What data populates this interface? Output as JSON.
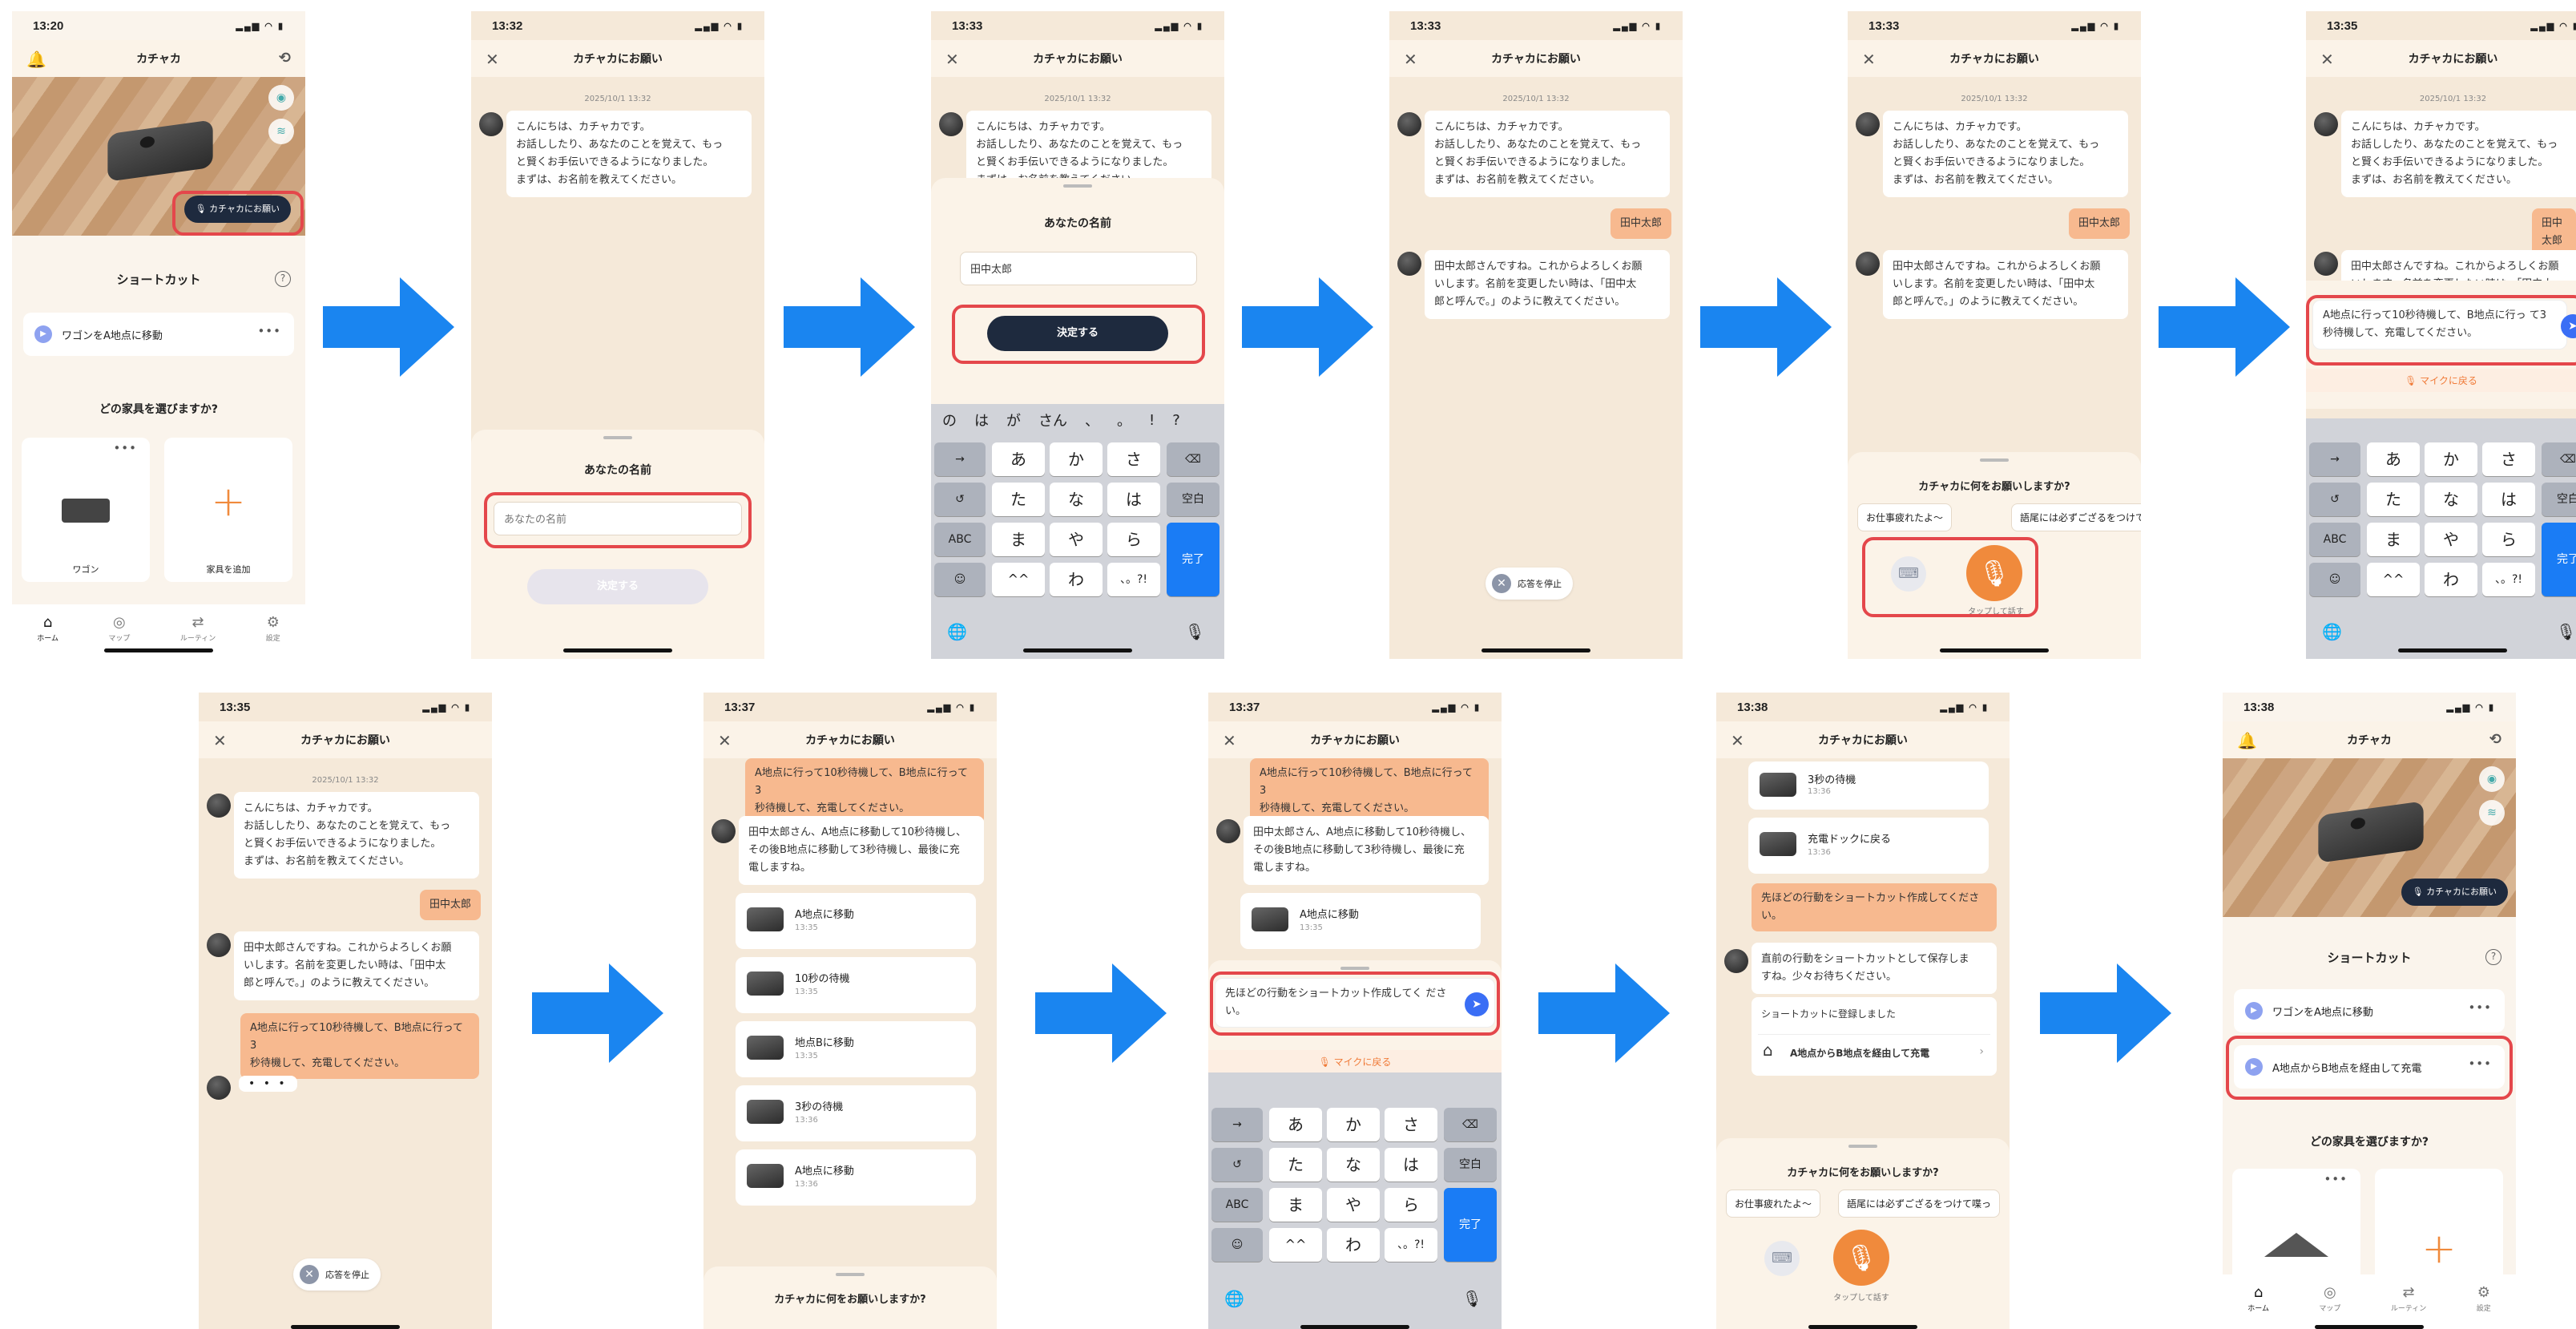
{
  "status": {
    "s1": "13:20",
    "s2": "13:32",
    "s3": "13:33",
    "s4": "13:33",
    "s5": "13:33",
    "s6": "13:35",
    "s7": "13:35",
    "s8": "13:37",
    "s9": "13:37",
    "s10": "13:38",
    "s11": "13:38",
    "icons": "▂▄▆ ◠ ▮"
  },
  "nav": {
    "home_title": "カチャカ",
    "chat_title": "カチャカにお願い",
    "close": "✕",
    "bell": "🔔",
    "history": "⟲"
  },
  "date": "2025/10/1 13:32",
  "chat": {
    "greeting": "こんにちは、カチャカです。\nお話ししたり、あなたのことを覚えて、もっ\nと賢くお手伝いできるようになりました。\nまずは、お名前を教えてください。",
    "user_name": "田中太郎",
    "reply_name": "田中太郎さんですね。これからよろしくお願\nいします。名前を変更したい時は、「田中太\n郎と呼んで。」のように教えてください。",
    "user_command": "A地点に行って10秒待機して、B地点に行って3\n秒待機して、充電してください。",
    "user_command_short": "A地点に行って10秒待機して、B地点に行って3\n秒待機して、充電してください。",
    "typing": "• • •",
    "plan": "田中太郎さん、A地点に移動して10秒待機し、\nその後B地点に移動して3秒待機し、最後に充\n電しますね。",
    "shortcut_request": "先ほどの行動をショートカット作成してくださ\nい。",
    "shortcut_reply": "直前の行動をショートカットとして保存しま\nすね。少々お待ちください。",
    "shortcut_done": "ショートカットに登録しました",
    "shortcut_name": "A地点からB地点を経由して充電"
  },
  "tasks": [
    {
      "title": "A地点に移動",
      "time": "13:35"
    },
    {
      "title": "10秒の待機",
      "time": "13:35"
    },
    {
      "title": "地点Bに移動",
      "time": "13:35"
    },
    {
      "title": "3秒の待機",
      "time": "13:36"
    },
    {
      "title": "A地点に移動",
      "time": "13:36"
    }
  ],
  "tasks_s10": [
    {
      "title": "3秒の待機",
      "time": "13:36"
    },
    {
      "title": "充電ドックに戻る",
      "time": "13:36"
    }
  ],
  "name_sheet": {
    "title": "あなたの名前",
    "placeholder": "あなたの名前",
    "value": "田中太郎",
    "decide": "決定する"
  },
  "compose": {
    "command_text": "A地点に行って10秒待機して、B地点に行っ\nて3秒待機して、充電してください。",
    "shortcut_text": "先ほどの行動をショートカット作成してく\nださい。",
    "back_to_mic": "🎙 マイクに戻る"
  },
  "voice_sheet": {
    "title": "カチャカに何をお願いしますか?",
    "chip1": "お仕事疲れたよ〜",
    "chip2": "語尾には必ずござるをつけて喋っ",
    "tap_to_talk": "タップして話す",
    "stop": "応答を停止"
  },
  "keyboard": {
    "suggestions": [
      "の",
      "は",
      "が",
      "さん",
      "、",
      "。",
      "!",
      "?"
    ],
    "rows": [
      [
        "→",
        "あ",
        "か",
        "さ",
        "⌫"
      ],
      [
        "↺",
        "た",
        "な",
        "は",
        "空白"
      ],
      [
        "ABC",
        "ま",
        "や",
        "ら",
        "完了"
      ],
      [
        "☺",
        "^^",
        "わ",
        "、。?!",
        ""
      ]
    ],
    "globe": "🌐",
    "mic": "🎙"
  },
  "home": {
    "ask_button": "🎙 カチャカにお願い",
    "shortcut_section": "ショートカット",
    "help": "?",
    "shortcut1": "ワゴンをA地点に移動",
    "shortcut2": "A地点からB地点を経由して充電",
    "furniture_section": "どの家具を選びますか?",
    "furniture1": "ワゴン",
    "furniture_add": "家具を追加",
    "more": "•••",
    "tabs": [
      "ホーム",
      "マップ",
      "ルーティン",
      "設定"
    ],
    "tab_icons": [
      "⌂",
      "◎",
      "⇄",
      "⚙"
    ]
  },
  "colors": {
    "arrow": "#1a85f0",
    "highlight": "#e4474b",
    "accent": "#f08a3c",
    "user_bubble": "#f7b98f",
    "dark_button": "#1e2a3e"
  }
}
